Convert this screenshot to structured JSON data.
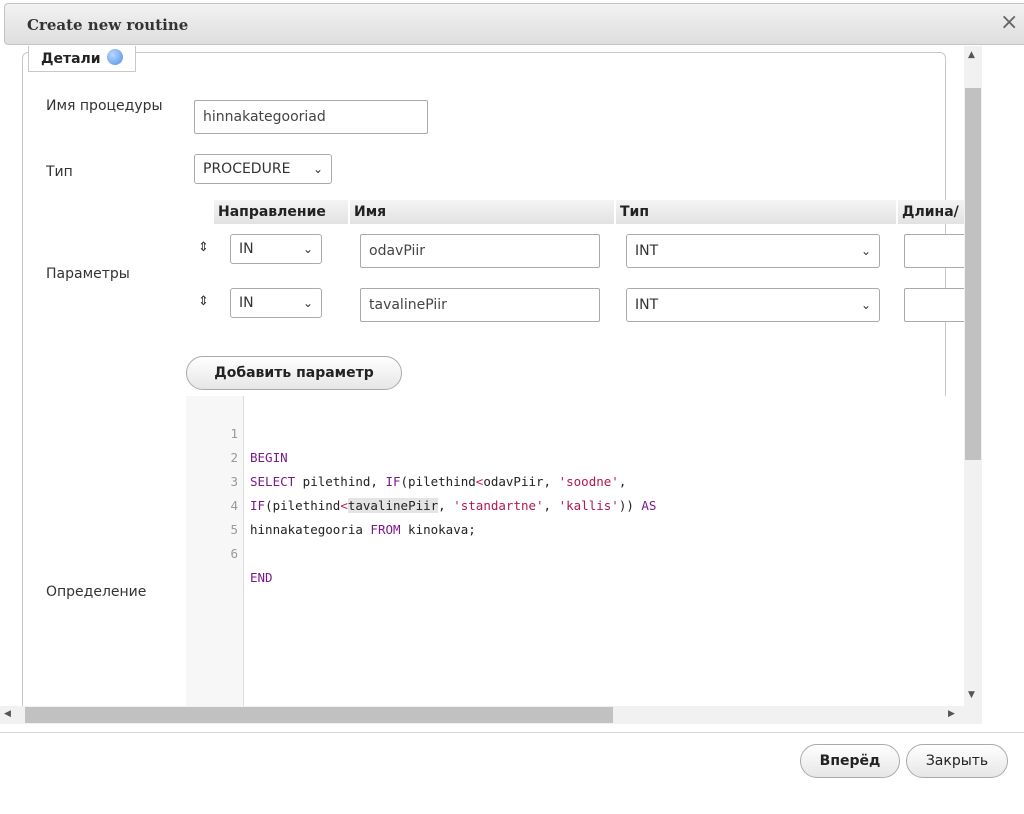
{
  "dialog": {
    "title": "Create new routine",
    "close_glyph": "×"
  },
  "details": {
    "legend": "Детали",
    "name_label": "Имя процедуры",
    "name_value": "hinnakategooriad",
    "type_label": "Тип",
    "type_value": "PROCEDURE",
    "params_label": "Параметры",
    "params_headers": [
      "Направление",
      "Имя",
      "Тип",
      "Длина/"
    ],
    "params": [
      {
        "direction": "IN",
        "name": "odavPiir",
        "type": "INT"
      },
      {
        "direction": "IN",
        "name": "tavalinePiir",
        "type": "INT"
      }
    ],
    "add_param_label": "Добавить параметр",
    "definition_label": "Определение"
  },
  "code": {
    "line_numbers": [
      "1",
      "2",
      "3",
      "4",
      "5",
      "6"
    ],
    "l1": {
      "kw": "BEGIN"
    },
    "l2": {
      "kw1": "SELECT",
      "t1": " pilethind, ",
      "kw2": "IF",
      "t2": "(pilethind",
      "op": "<",
      "t3": "odavPiir, ",
      "str": "'soodne'",
      "t4": ","
    },
    "l3": {
      "kw1": "IF",
      "t1": "(pilethind",
      "op": "<",
      "hl": "tavalinePiir",
      "t2": ", ",
      "str1": "'standartne'",
      "t3": ", ",
      "str2": "'kallis'",
      "t4": ")) ",
      "kw2": "AS"
    },
    "l4": {
      "t1": "hinnakategooria ",
      "kw": "FROM",
      "t2": " kinokava;"
    },
    "l6": {
      "kw": "END"
    }
  },
  "footer": {
    "next_label": "Вперёд",
    "close_label": "Закрыть"
  },
  "icons": {
    "help": "help-icon",
    "drag": "drag-handle-icon",
    "chevron": "chevron-down-icon"
  }
}
